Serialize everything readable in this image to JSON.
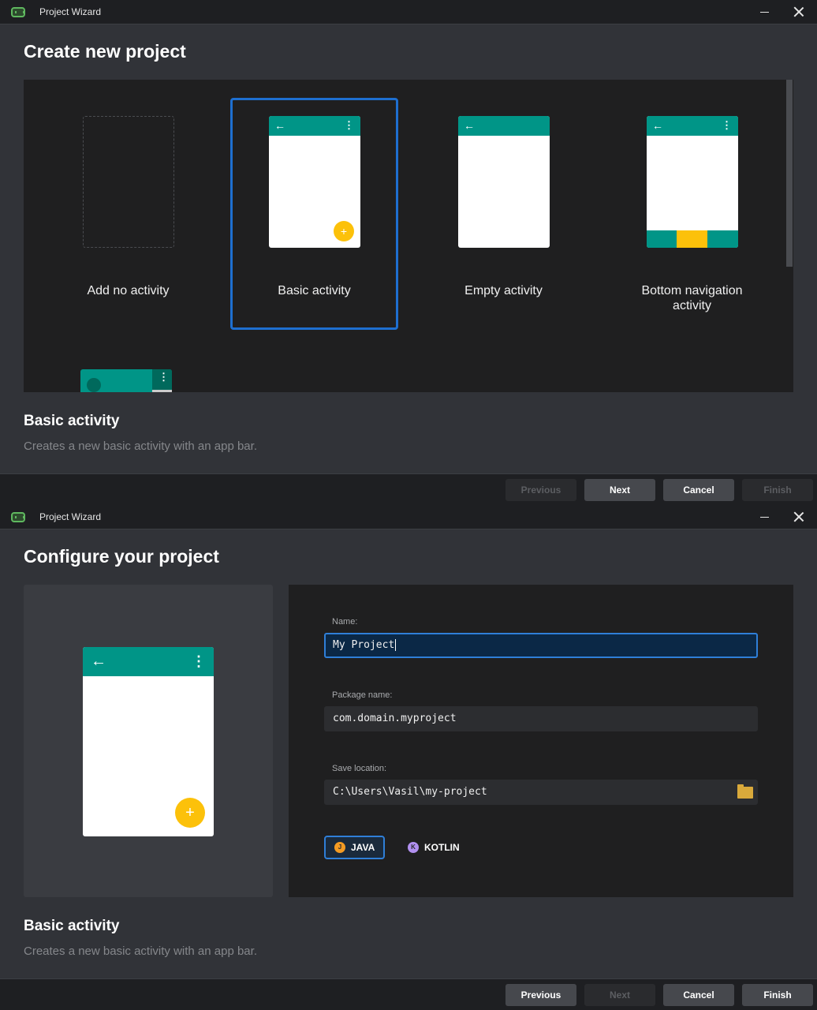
{
  "window_title": "Project Wizard",
  "step1": {
    "heading": "Create new project",
    "tiles": [
      {
        "label": "Add no activity"
      },
      {
        "label": "Basic activity"
      },
      {
        "label": "Empty activity"
      },
      {
        "label": "Bottom navigation activity"
      }
    ],
    "selected_tile": "Basic activity",
    "description_title": "Basic activity",
    "description_text": "Creates a new basic activity with an app bar.",
    "buttons": {
      "previous": "Previous",
      "next": "Next",
      "cancel": "Cancel",
      "finish": "Finish"
    }
  },
  "step2": {
    "heading": "Configure your project",
    "form": {
      "name_label": "Name:",
      "name_value": "My Project",
      "package_label": "Package name:",
      "package_value": "com.domain.myproject",
      "location_label": "Save location:",
      "location_value": "C:\\Users\\Vasil\\my-project"
    },
    "languages": [
      {
        "badge": "J",
        "label": "JAVA",
        "selected": true
      },
      {
        "badge": "K",
        "label": "KOTLIN",
        "selected": false
      }
    ],
    "description_title": "Basic activity",
    "description_text": "Creates a new basic activity with an app bar.",
    "buttons": {
      "previous": "Previous",
      "next": "Next",
      "cancel": "Cancel",
      "finish": "Finish"
    }
  },
  "icons": {
    "back": "←",
    "overflow": "⋮",
    "fab": "+"
  },
  "colors": {
    "accent": "#1e6fd0",
    "appbar": "#009587",
    "fab": "#fcc10a"
  }
}
